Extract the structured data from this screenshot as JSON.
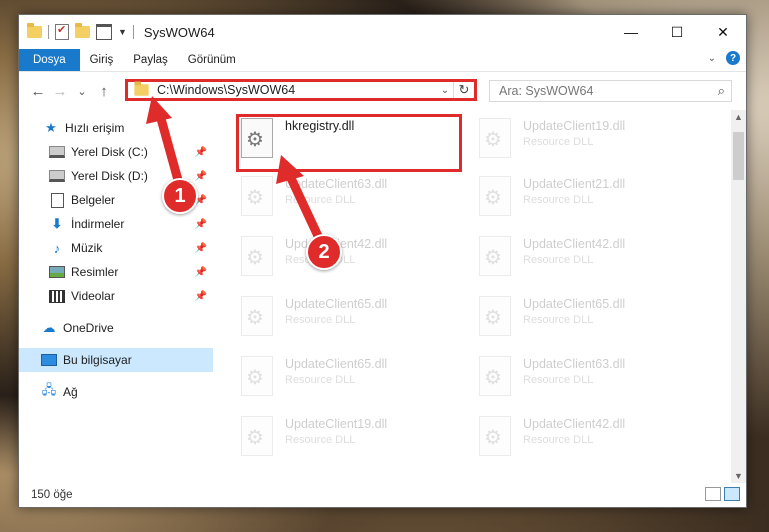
{
  "window": {
    "title": "SysWOW64",
    "controls": {
      "minimize": "—",
      "maximize": "☐",
      "close": "✕"
    }
  },
  "ribbon": {
    "tabs": [
      "Dosya",
      "Giriş",
      "Paylaş",
      "Görünüm"
    ],
    "help_label": "?"
  },
  "navigation": {
    "back_icon": "←",
    "forward_icon": "→",
    "recent_icon": "⌄",
    "up_icon": "↑",
    "address": "C:\\Windows\\SysWOW64",
    "refresh_icon": "↻",
    "search_placeholder": "Ara: SysWOW64",
    "search_icon": "⌕"
  },
  "sidebar": {
    "items": [
      {
        "label": "Hızlı erişim",
        "icon": "star-icon",
        "pinned": false
      },
      {
        "label": "Yerel Disk (C:)",
        "icon": "drive-icon",
        "pinned": true
      },
      {
        "label": "Yerel Disk (D:)",
        "icon": "drive-icon",
        "pinned": true
      },
      {
        "label": "Belgeler",
        "icon": "document-icon",
        "pinned": true
      },
      {
        "label": "İndirmeler",
        "icon": "download-icon",
        "pinned": true
      },
      {
        "label": "Müzik",
        "icon": "music-icon",
        "pinned": true
      },
      {
        "label": "Resimler",
        "icon": "pictures-icon",
        "pinned": true
      },
      {
        "label": "Videolar",
        "icon": "videos-icon",
        "pinned": true
      },
      {
        "label": "OneDrive",
        "icon": "cloud-icon",
        "pinned": false
      },
      {
        "label": "Bu bilgisayar",
        "icon": "computer-icon",
        "pinned": false,
        "selected": true
      },
      {
        "label": "Ağ",
        "icon": "network-icon",
        "pinned": false
      }
    ],
    "pin_icon": "📌"
  },
  "files": {
    "items": [
      {
        "name": "hkregistry.dll",
        "type": "",
        "faded": false
      },
      {
        "name": "UpdateClient19.dll",
        "type": "Resource DLL",
        "faded": true
      },
      {
        "name": "UpdateClient63.dll",
        "type": "Resource DLL",
        "faded": true
      },
      {
        "name": "UpdateClient21.dll",
        "type": "Resource DLL",
        "faded": true
      },
      {
        "name": "UpdateClient42.dll",
        "type": "Resource DLL",
        "faded": true
      },
      {
        "name": "UpdateClient42.dll",
        "type": "Resource DLL",
        "faded": true
      },
      {
        "name": "UpdateClient65.dll",
        "type": "Resource DLL",
        "faded": true
      },
      {
        "name": "UpdateClient65.dll",
        "type": "Resource DLL",
        "faded": true
      },
      {
        "name": "UpdateClient65.dll",
        "type": "Resource DLL",
        "faded": true
      },
      {
        "name": "UpdateClient63.dll",
        "type": "Resource DLL",
        "faded": true
      },
      {
        "name": "UpdateClient19.dll",
        "type": "Resource DLL",
        "faded": true
      },
      {
        "name": "UpdateClient42.dll",
        "type": "Resource DLL",
        "faded": true
      }
    ]
  },
  "status": {
    "count": "150 öğe"
  },
  "annotations": {
    "step1": "1",
    "step2": "2",
    "color": "#e02b2b"
  }
}
